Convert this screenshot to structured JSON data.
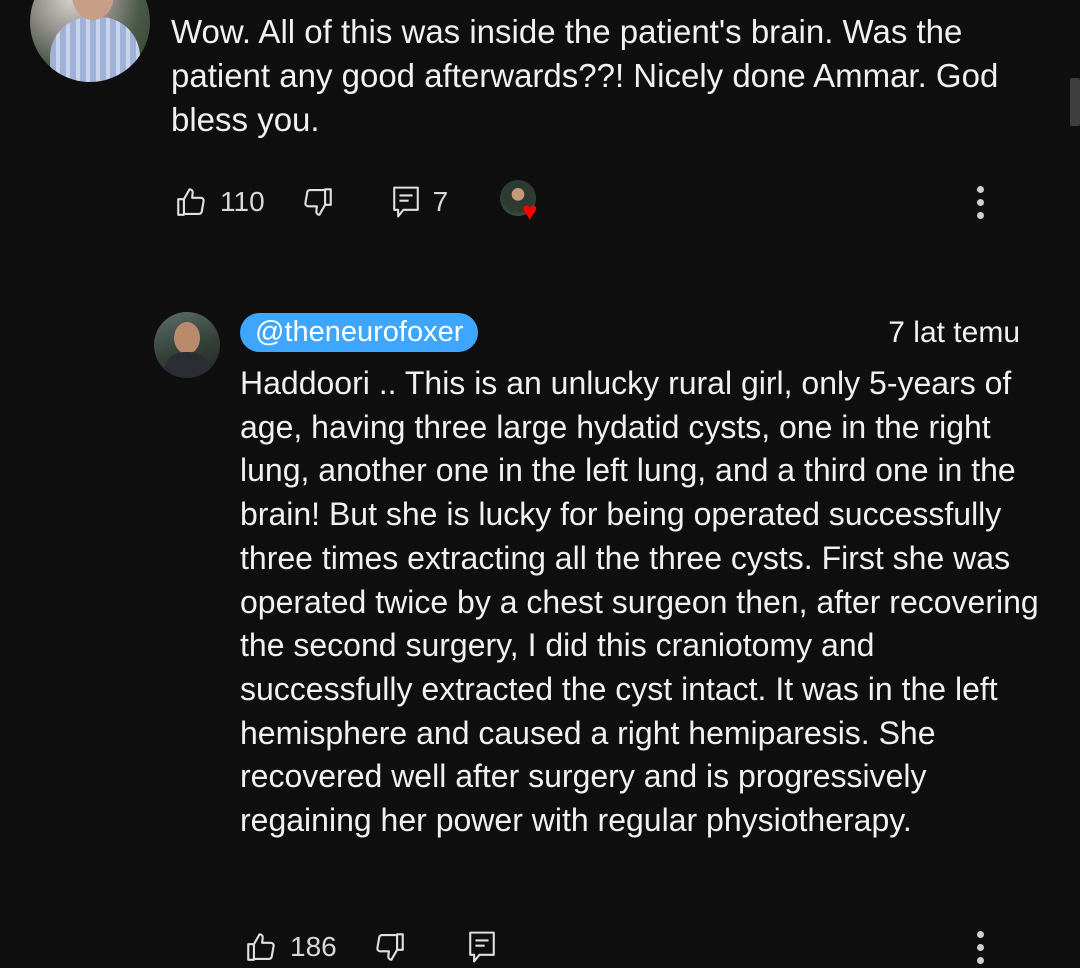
{
  "top_comment": {
    "text": "Wow. All of this was inside the patient's brain. Was the patient any good afterwards??! Nicely done Ammar. God bless you.",
    "likes": "110",
    "replies": "7",
    "hearted": true
  },
  "reply": {
    "author": "@theneurofoxer",
    "timestamp": "7 lat temu",
    "text": "Haddoori .. This is an unlucky rural girl, only 5-years of age, having three large hydatid cysts, one in the right lung, another one in the left lung, and a third one in the brain! But she is lucky for being operated successfully three times extracting all the three cysts. First she was operated twice by a chest surgeon then, after recovering the second surgery, I did this craniotomy and successfully extracted the cyst intact. It was in the left hemisphere and caused a right hemiparesis. She recovered well after surgery and is progressively regaining her power with regular physiotherapy.",
    "likes": "186"
  },
  "icons": {
    "like": "thumbs-up-icon",
    "dislike": "thumbs-down-icon",
    "reply": "comment-icon",
    "more": "more-vert-icon",
    "heart": "heart-icon"
  },
  "colors": {
    "background": "#0f0f0f",
    "author_chip": "#3ea6ff",
    "heart": "#ff0000"
  }
}
